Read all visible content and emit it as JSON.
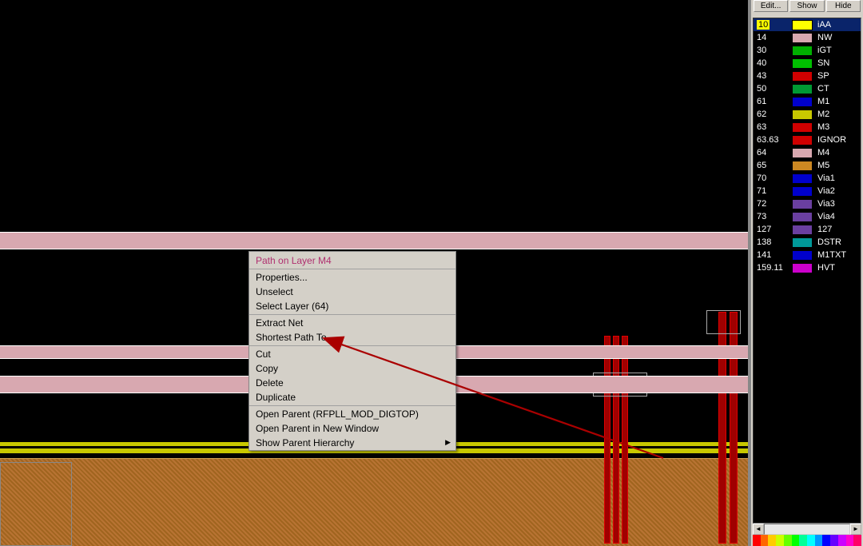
{
  "context_menu": {
    "title": "Path on Layer M4",
    "groups": [
      [
        "Properties...",
        "Unselect",
        "Select Layer (64)"
      ],
      [
        "Extract Net",
        "Shortest Path To..."
      ],
      [
        "Cut",
        "Copy",
        "Delete",
        "Duplicate"
      ],
      [
        "Open Parent (RFPLL_MOD_DIGTOP)",
        "Open Parent in New Window",
        "Show Parent Hierarchy"
      ]
    ],
    "submenu_on": "Show Parent Hierarchy"
  },
  "annotation_target": "Extract Net",
  "side_panel": {
    "buttons": [
      "Edit...",
      "Show",
      "Hide"
    ],
    "layers": [
      {
        "num": "10",
        "name": "iAA",
        "color": "#ffff00",
        "selected": true
      },
      {
        "num": "14",
        "name": "NW",
        "color": "#d8a8b0"
      },
      {
        "num": "30",
        "name": "iGT",
        "color": "#00b000"
      },
      {
        "num": "40",
        "name": "SN",
        "color": "#00c000"
      },
      {
        "num": "43",
        "name": "SP",
        "color": "#d00000"
      },
      {
        "num": "50",
        "name": "CT",
        "color": "#009933"
      },
      {
        "num": "61",
        "name": "M1",
        "color": "#0000cc"
      },
      {
        "num": "62",
        "name": "M2",
        "color": "#c8c800"
      },
      {
        "num": "63",
        "name": "M3",
        "color": "#d00000"
      },
      {
        "num": "63.63",
        "name": "IGNOR",
        "color": "#d00000"
      },
      {
        "num": "64",
        "name": "M4",
        "color": "#d8a8b0"
      },
      {
        "num": "65",
        "name": "M5",
        "color": "#cc8822"
      },
      {
        "num": "70",
        "name": "Via1",
        "color": "#0000cc"
      },
      {
        "num": "71",
        "name": "Via2",
        "color": "#0000cc"
      },
      {
        "num": "72",
        "name": "Via3",
        "color": "#6a3fa0"
      },
      {
        "num": "73",
        "name": "Via4",
        "color": "#6a3fa0"
      },
      {
        "num": "127",
        "name": "127",
        "color": "#6a3fa0"
      },
      {
        "num": "138",
        "name": "DSTR",
        "color": "#009999"
      },
      {
        "num": "141",
        "name": "M1TXT",
        "color": "#0000cc"
      },
      {
        "num": "159.11",
        "name": "HVT",
        "color": "#cc00cc"
      }
    ]
  },
  "palette": [
    "#ff0000",
    "#ff6600",
    "#ffcc00",
    "#ccff00",
    "#66ff00",
    "#00ff00",
    "#00ff99",
    "#00ffff",
    "#0099ff",
    "#0000ff",
    "#6600ff",
    "#cc00ff",
    "#ff00cc",
    "#ff0066"
  ]
}
